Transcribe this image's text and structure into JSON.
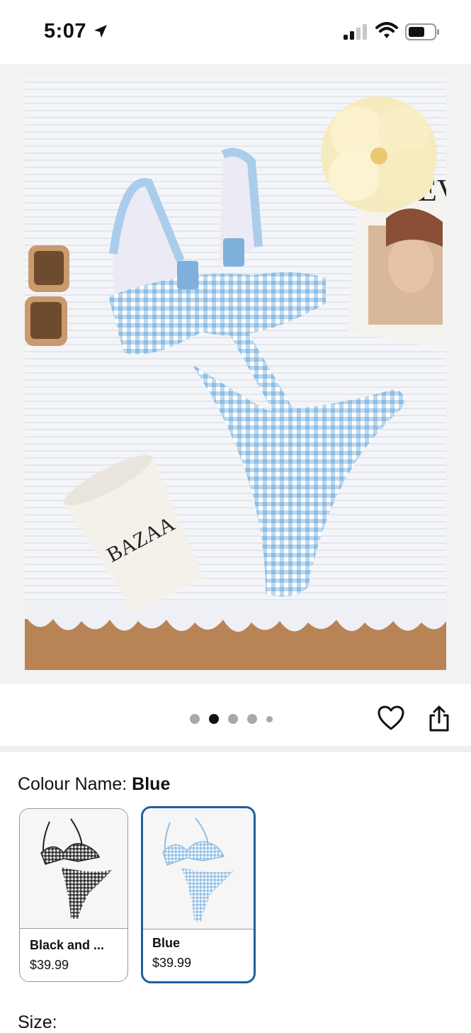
{
  "status_bar": {
    "time": "5:07",
    "icons": [
      "location-arrow-icon",
      "cellular-signal-icon",
      "wifi-icon",
      "battery-icon"
    ]
  },
  "gallery": {
    "image_description": "blue gingham bikini flat lay",
    "page_count": 5,
    "active_index": 1
  },
  "actions": {
    "icons": [
      "heart-icon",
      "share-icon"
    ]
  },
  "colour": {
    "label_prefix": "Colour Name: ",
    "selected": "Blue",
    "options": [
      {
        "name": "Black and ...",
        "price": "$39.99",
        "selected": false
      },
      {
        "name": "Blue",
        "price": "$39.99",
        "selected": true
      }
    ]
  },
  "size": {
    "label": "Size: "
  },
  "colors": {
    "selected_border": "#1f5fa0",
    "gingham_blue": "#a9cdea",
    "gingham_black": "#3a3a3a"
  }
}
